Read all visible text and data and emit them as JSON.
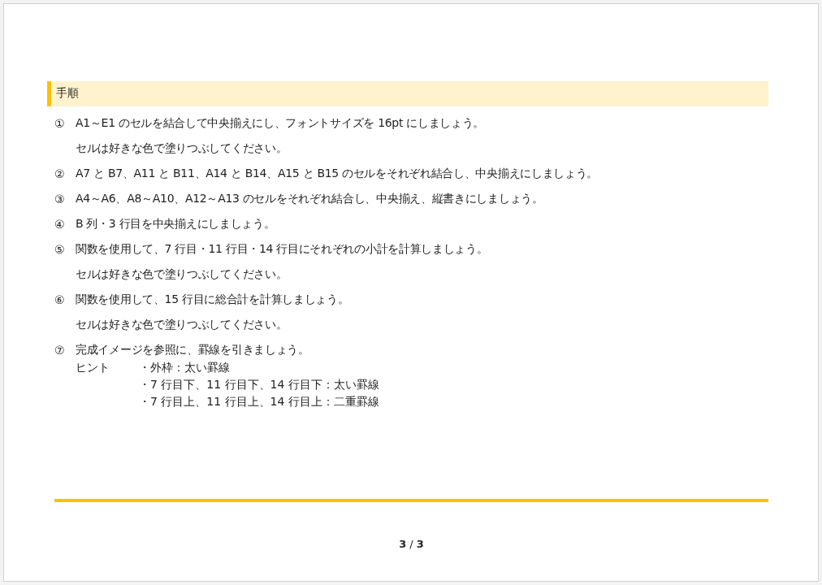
{
  "section": {
    "title": "手順"
  },
  "steps": [
    {
      "number": "①",
      "text": "A1～E1 のセルを結合して中央揃えにし、フォントサイズを 16pt にしましょう。",
      "notes": [
        "セルは好きな色で塗りつぶしてください。"
      ]
    },
    {
      "number": "②",
      "text": "A7 と B7、A11 と B11、A14 と B14、A15 と B15 のセルをそれぞれ結合し、中央揃えにしましょう。"
    },
    {
      "number": "③",
      "text": "A4～A6、A8～A10、A12～A13 のセルをそれぞれ結合し、中央揃え、縦書きにしましょう。"
    },
    {
      "number": "④",
      "text": "B 列・3 行目を中央揃えにしましょう。"
    },
    {
      "number": "⑤",
      "text": "関数を使用して、7 行目・11 行目・14 行目にそれぞれの小計を計算しましょう。",
      "notes": [
        "セルは好きな色で塗りつぶしてください。"
      ]
    },
    {
      "number": "⑥",
      "text": "関数を使用して、15 行目に総合計を計算しましょう。",
      "notes": [
        "セルは好きな色で塗りつぶしてください。"
      ]
    },
    {
      "number": "⑦",
      "text": "完成イメージを参照に、罫線を引きましょう。",
      "hint": {
        "label": "ヒント",
        "items": [
          "・外枠：太い罫線",
          "・7 行目下、11 行目下、14 行目下：太い罫線",
          "・7 行目上、11 行目上、14 行目上：二重罫線"
        ]
      }
    }
  ],
  "page_number": "**3** / **3**"
}
